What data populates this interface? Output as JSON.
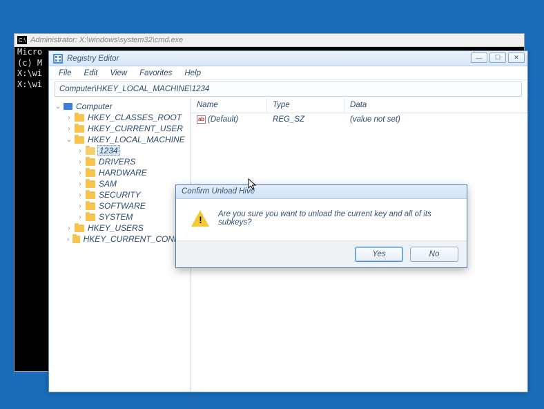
{
  "cmd": {
    "title": "Administrator: X:\\windows\\system32\\cmd.exe",
    "lines": [
      "Micro",
      "(c) M",
      "",
      "X:\\wi",
      "",
      "X:\\wi"
    ]
  },
  "regedit": {
    "title": "Registry Editor",
    "menu": [
      "File",
      "Edit",
      "View",
      "Favorites",
      "Help"
    ],
    "address": "Computer\\HKEY_LOCAL_MACHINE\\1234",
    "columns": {
      "name": "Name",
      "type": "Type",
      "data": "Data"
    },
    "values": [
      {
        "name": "(Default)",
        "type": "REG_SZ",
        "data": "(value not set)"
      }
    ],
    "tree": {
      "root": "Computer",
      "hives": [
        {
          "name": "HKEY_CLASSES_ROOT",
          "expanded": false
        },
        {
          "name": "HKEY_CURRENT_USER",
          "expanded": false
        },
        {
          "name": "HKEY_LOCAL_MACHINE",
          "expanded": true,
          "children": [
            {
              "name": "1234",
              "selected": true
            },
            {
              "name": "DRIVERS"
            },
            {
              "name": "HARDWARE"
            },
            {
              "name": "SAM"
            },
            {
              "name": "SECURITY"
            },
            {
              "name": "SOFTWARE"
            },
            {
              "name": "SYSTEM"
            }
          ]
        },
        {
          "name": "HKEY_USERS",
          "expanded": false
        },
        {
          "name": "HKEY_CURRENT_CONFIG",
          "expanded": false
        }
      ]
    }
  },
  "dialog": {
    "title": "Confirm Unload Hive",
    "message": "Are you sure you want to unload the current key and all of its subkeys?",
    "yes": "Yes",
    "no": "No"
  }
}
